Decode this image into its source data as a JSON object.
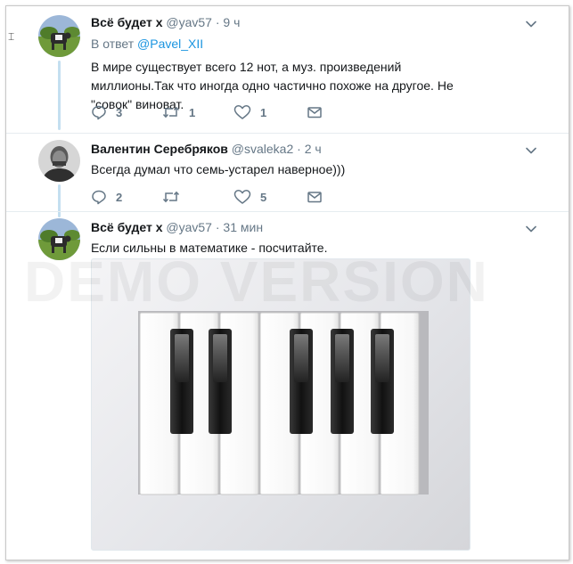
{
  "tweets": [
    {
      "name": "Всё будет х",
      "handle": "@yav57",
      "dot": "·",
      "time": "9 ч",
      "reply_prefix": "В ответ",
      "reply_user": "@Pavel_XII",
      "text": "В мире существует всего 12 нот, а муз. произведений миллионы.Так что иногда одно частично похоже на другое. Не \"совок\" виноват.",
      "replies": "3",
      "retweets": "1",
      "likes": "1"
    },
    {
      "name": "Валентин Серебряков",
      "handle": "@svaleka2",
      "dot": "·",
      "time": "2 ч",
      "text": "Всегда думал что семь-устарел наверное)))",
      "replies": "2",
      "retweets": "",
      "likes": "5"
    },
    {
      "name": "Всё будет х",
      "handle": "@yav57",
      "dot": "·",
      "time": "31 мин",
      "text": "Если сильны в математике - посчитайте."
    }
  ],
  "watermark": "DEMO VERSION",
  "icons": {
    "reply": "reply-icon",
    "retweet": "retweet-icon",
    "like": "heart-icon",
    "dm": "envelope-icon",
    "more": "chevron-down-icon"
  },
  "colors": {
    "link": "#1b95e0",
    "muted": "#657786",
    "thread_line": "#c4dff0"
  }
}
